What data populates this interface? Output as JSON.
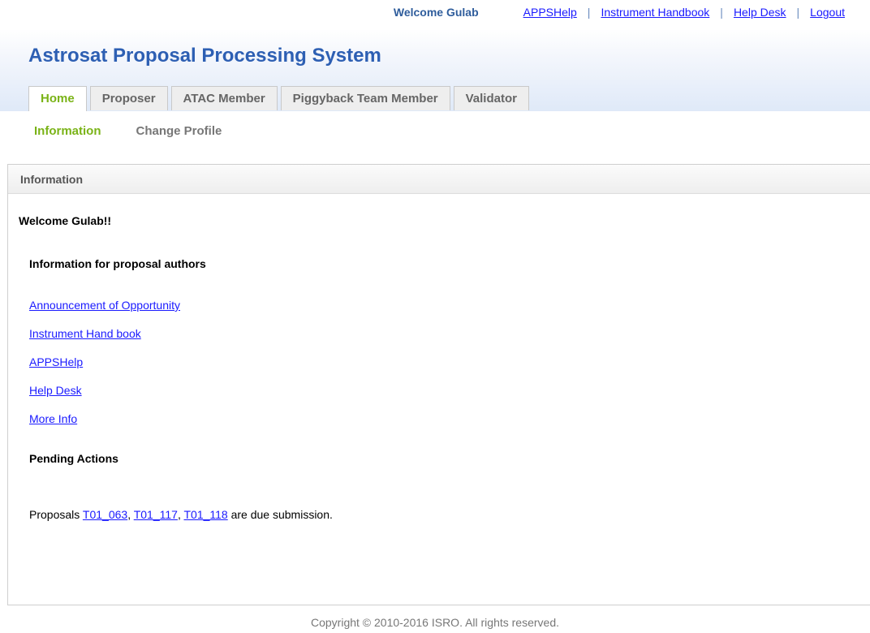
{
  "topbar": {
    "welcome": "Welcome Gulab",
    "links": [
      "APPSHelp",
      "Instrument Handbook",
      "Help Desk",
      "Logout"
    ],
    "separator": "|"
  },
  "app": {
    "title": "Astrosat Proposal Processing System"
  },
  "tabs": [
    "Home",
    "Proposer",
    "ATAC Member",
    "Piggyback Team Member",
    "Validator"
  ],
  "active_tab": "Home",
  "subnav": {
    "items": [
      "Information",
      "Change Profile"
    ],
    "active": "Information"
  },
  "panel": {
    "title": "Information",
    "welcome": "Welcome Gulab!!",
    "info_heading": "Information for proposal authors",
    "links": [
      "Announcement of Opportunity",
      "Instrument Hand book",
      "APPSHelp",
      "Help Desk",
      "More Info"
    ],
    "pending_heading": "Pending Actions",
    "pending": {
      "prefix": "Proposals",
      "proposals": [
        "T01_063",
        "T01_117",
        "T01_118"
      ],
      "comma1": ", ",
      "comma2": ", ",
      "suffix": "are due submission."
    }
  },
  "footer": {
    "copyright": "Copyright © 2010-2016 ISRO. All rights reserved."
  },
  "colors": {
    "title_blue": "#2d5fb3",
    "active_green": "#7ab317",
    "link_blue": "#1a1aff"
  }
}
